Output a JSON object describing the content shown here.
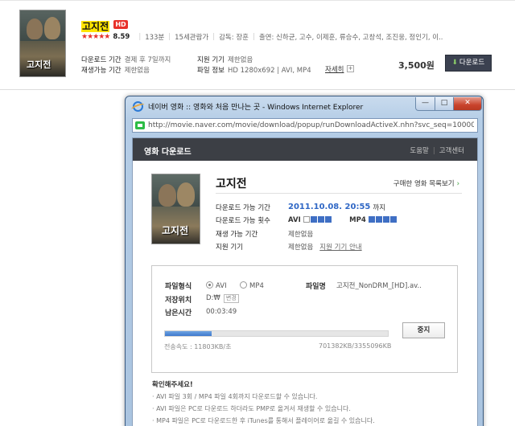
{
  "listing": {
    "title_highlight": "고지전",
    "hd_badge": "HD",
    "stars": "★★★★★",
    "rating": "8.59",
    "run_time": "133분",
    "age": "15세관람가",
    "director": "감독: 장훈",
    "cast": "출연: 신하균, 고수, 이제훈, 류승수, 고창석, 조진웅, 정인기, 이..",
    "poster_text": "고지전",
    "dl_period_label": "다운로드 기간",
    "dl_period_value": "결제 후 7일까지",
    "play_period_label": "재생가능 기간",
    "play_period_value": "제한없음",
    "device_label": "지원 기기",
    "device_value": "제한없음",
    "file_label": "파일 정보",
    "file_value": "HD 1280x692 | AVI, MP4",
    "detail_link": "자세히",
    "detail_plus": "+",
    "price": "3,500원",
    "download_button": "다운로드"
  },
  "ie": {
    "window_title": "네이버 영화 :: 영화와 처음 만나는 곳 - Windows Internet Explorer",
    "minimize": "—",
    "maximize": "□",
    "close": "✕",
    "address": "http://movie.naver.com/movie/download/popup/runDownloadActiveX.nhn?svc_seq=1000097C"
  },
  "popup": {
    "header_title": "영화 다운로드",
    "help_link": "도움말",
    "support_link": "고객센터",
    "movie_title": "고지전",
    "poster_text": "고지전",
    "purchased_link": "구매한 영화 목록보기",
    "purchased_arrow": "›",
    "rows": {
      "dl_period_label": "다운로드 가능 기간",
      "dl_period_date": "2011.10.08. 20:55",
      "dl_period_suffix": "까지",
      "dl_count_label": "다운로드 가능 횟수",
      "avi_label": "AVI",
      "mp4_label": "MP4",
      "play_period_label": "재생 가능 기간",
      "play_period_value": "제한없음",
      "device_label": "지원 기기",
      "device_value": "제한없음",
      "device_link": "지원 기기 안내"
    },
    "download": {
      "format_label": "파일형식",
      "format_avi": "AVI",
      "format_mp4": "MP4",
      "selected_format": "AVI",
      "filename_label": "파일명",
      "filename_value": "고지전_NonDRM_[HD].av..",
      "save_label": "저장위치",
      "save_value": "D:₩",
      "change_button": "변경",
      "remain_label": "남은시간",
      "remain_value": "00:03:49",
      "progress_percent": 21,
      "speed_text": "전송속도 : 11803KB/초",
      "bytes_text": "701382KB/3355096KB",
      "stop_button": "중지"
    },
    "notice_title": "확인해주세요!",
    "notice_lines": [
      "· AVI 파일 3회 / MP4 파일 4회까지 다운로드할 수 있습니다.",
      "· AVI 파일은 PC로 다운로드 하더라도 PMP로 옮겨서 재생할 수 있습니다.",
      "· MP4 파일은 PC로 다운로드한 후 iTunes를 통해서 플레이어로 옮길 수 있습니다."
    ]
  }
}
